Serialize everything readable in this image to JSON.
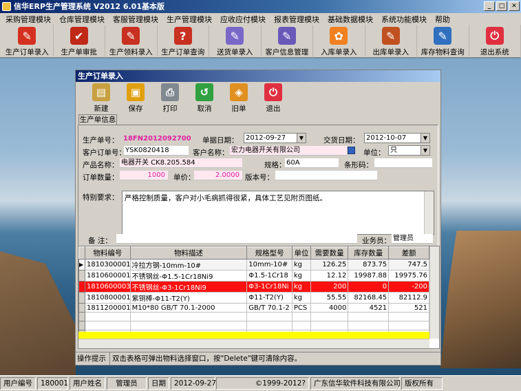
{
  "app": {
    "title": "信华ERP生产管理系统  V2012  6.01基本版",
    "win_min": "_",
    "win_max": "□",
    "win_close": "✕"
  },
  "menu": [
    "采购管理模块",
    "仓库管理模块",
    "客服管理模块",
    "生产管理模块",
    "应收应付模块",
    "报表管理模块",
    "基础数据模块",
    "系统功能模块",
    "帮助"
  ],
  "toolbar": [
    {
      "label": "生产订单录入",
      "icon": "pdf-icon",
      "color": "#d43020",
      "glyph": "✎"
    },
    {
      "label": "生产单审批",
      "icon": "pdf-icon",
      "color": "#c02818",
      "glyph": "✔"
    },
    {
      "label": "生产领料录入",
      "icon": "pdf-icon",
      "color": "#c83020",
      "glyph": "✎"
    },
    {
      "label": "生产订单查询",
      "icon": "pdf-icon",
      "color": "#c83020",
      "glyph": "?"
    },
    {
      "label": "送货单录入",
      "icon": "pen-icon",
      "color": "#7a68c8",
      "glyph": "✎"
    },
    {
      "label": "客户信息管理",
      "icon": "pen-icon",
      "color": "#6a58b8",
      "glyph": "✎"
    },
    {
      "label": "入库单录入",
      "icon": "flower-icon",
      "color": "#f08020",
      "glyph": "✿"
    },
    {
      "label": "出库单录入",
      "icon": "document-icon",
      "color": "#c05020",
      "glyph": "✎"
    },
    {
      "label": "库存物料查询",
      "icon": "feather-icon",
      "color": "#3070c0",
      "glyph": "✎"
    },
    {
      "label": "退出系统",
      "icon": "exit-icon",
      "color": "#e03040",
      "glyph": "⏻"
    }
  ],
  "child": {
    "title": "生产订单录入",
    "tools": [
      {
        "label": "新建",
        "icon": "new-icon",
        "color": "#c8a040",
        "glyph": "▤"
      },
      {
        "label": "保存",
        "icon": "save-icon",
        "color": "#e0a010",
        "glyph": "▣"
      },
      {
        "label": "打印",
        "icon": "print-icon",
        "color": "#808890",
        "glyph": "⎙"
      },
      {
        "label": "取消",
        "icon": "cancel-icon",
        "color": "#30a040",
        "glyph": "↺"
      },
      {
        "label": "旧单",
        "icon": "old-order-icon",
        "color": "#e09020",
        "glyph": "◈"
      },
      {
        "label": "退出",
        "icon": "exit-icon",
        "color": "#e03040",
        "glyph": "⏻"
      }
    ],
    "tab": "生产单信息",
    "labels": {
      "order_no": "生产单号：",
      "date": "单据日期：",
      "delivery": "交货日期：",
      "cust_order": "客户订单号：",
      "cust_name": "客户名称：",
      "unit": "单位：",
      "product": "产品名称：",
      "spec": "规格：",
      "barcode": "条形码：",
      "qty": "订单数量：",
      "price": "单价：",
      "version": "版本号：",
      "special": "特别要求：",
      "remark": "备  注：",
      "salesman": "业务员："
    },
    "values": {
      "order_no": "18FN20120927002",
      "date": "2012-09-27",
      "delivery": "2012-10-07",
      "cust_order": "YSK0820418",
      "cust_name": "宏力电器开关有限公司",
      "unit": "只",
      "product": "电器开关 CK8.205.584",
      "spec": "60A",
      "barcode": "",
      "qty": "1000",
      "price": "2.0000",
      "version": "",
      "special": "严格控制质量，客户对小毛病抓得很紧，具体工艺见附页图纸。",
      "remark": "",
      "salesman": "管理员"
    },
    "grid": {
      "headers": [
        "物料编号",
        "物料描述",
        "规格型号",
        "单位",
        "需要数量",
        "库存数量",
        "差额"
      ],
      "rows": [
        [
          "1810300001",
          "冷拉方钢-10mm-10#",
          "10mm-10#",
          "kg",
          "126.25",
          "873.75",
          "747.5"
        ],
        [
          "1810600001",
          "不锈钢丝-Φ1.5-1Cr18Ni9",
          "Φ1.5-1Cr18",
          "kg",
          "12.12",
          "19987.88",
          "19975.76"
        ],
        [
          "1810600003",
          "不锈钢丝-Φ3-1Cr18Ni9",
          "Φ3-1Cr18Ni",
          "kg",
          "200",
          "0",
          "-200"
        ],
        [
          "1810800001",
          "紫铜棒-Φ11-T2(Y)",
          "Φ11-T2(Y)",
          "kg",
          "55.55",
          "82168.45",
          "82112.9"
        ],
        [
          "1811200001",
          "M10*80 GB/T 70.1-2000",
          "GB/T 70.1-2",
          "PCS",
          "4000",
          "4521",
          "521"
        ]
      ]
    },
    "hint_label": "操作提示",
    "hint_text": "双击表格可弹出物料选择窗口，按\"Delete\"键可清除内容。"
  },
  "status": {
    "user_no_label": "用户编号",
    "user_no": "180001",
    "user_name_label": "用户姓名",
    "user_name": "管理员",
    "date_label": "日期",
    "date": "2012-09-27",
    "copyright": "©1999-2012?",
    "company": "广东信华软件科技有限公司",
    "rights": "版权所有"
  }
}
